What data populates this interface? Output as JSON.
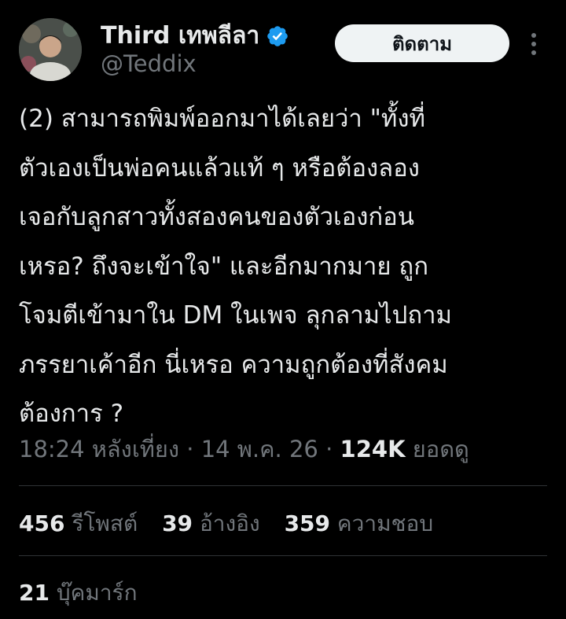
{
  "author": {
    "name": "Third เทพลีลา",
    "handle": "@Teddix",
    "verified": true
  },
  "follow_button_label": "ติดตาม",
  "more_icon": "more-vertical-icon",
  "tweet_lines": [
    "(2) สามารถพิมพ์ออกมาได้เลยว่า \"ทั้งที่",
    "ตัวเองเป็นพ่อคนแล้วแท้ ๆ หรือต้องลอง",
    "เจอกับลูกสาวทั้งสองคนของตัวเองก่อน",
    "เหรอ? ถึงจะเข้าใจ\" และอีกมากมาย ถูก",
    "โจมตีเข้ามาใน DM ในเพจ ลุกลามไปถาม",
    "ภรรยาเค้าอีก นี่เหรอ ความถูกต้องที่สังคม",
    "ต้องการ ?"
  ],
  "meta": {
    "time": "18:24 หลังเที่ยง",
    "sep1": " · ",
    "date": "14 พ.ค. 26",
    "sep2": " · ",
    "views": "124K",
    "views_label": " ยอดดู"
  },
  "stats": {
    "reposts_count": "456",
    "reposts_label": " รีโพสต์",
    "quotes_count": "39",
    "quotes_label": " อ้างอิง",
    "likes_count": "359",
    "likes_label": " ความชอบ",
    "bookmarks_count": "21",
    "bookmarks_label": " บุ๊คมาร์ก"
  },
  "colors": {
    "background": "#000000",
    "text": "#e7e9ea",
    "secondary": "#71767b",
    "verified": "#1d9bf0",
    "divider": "#2f3336"
  }
}
